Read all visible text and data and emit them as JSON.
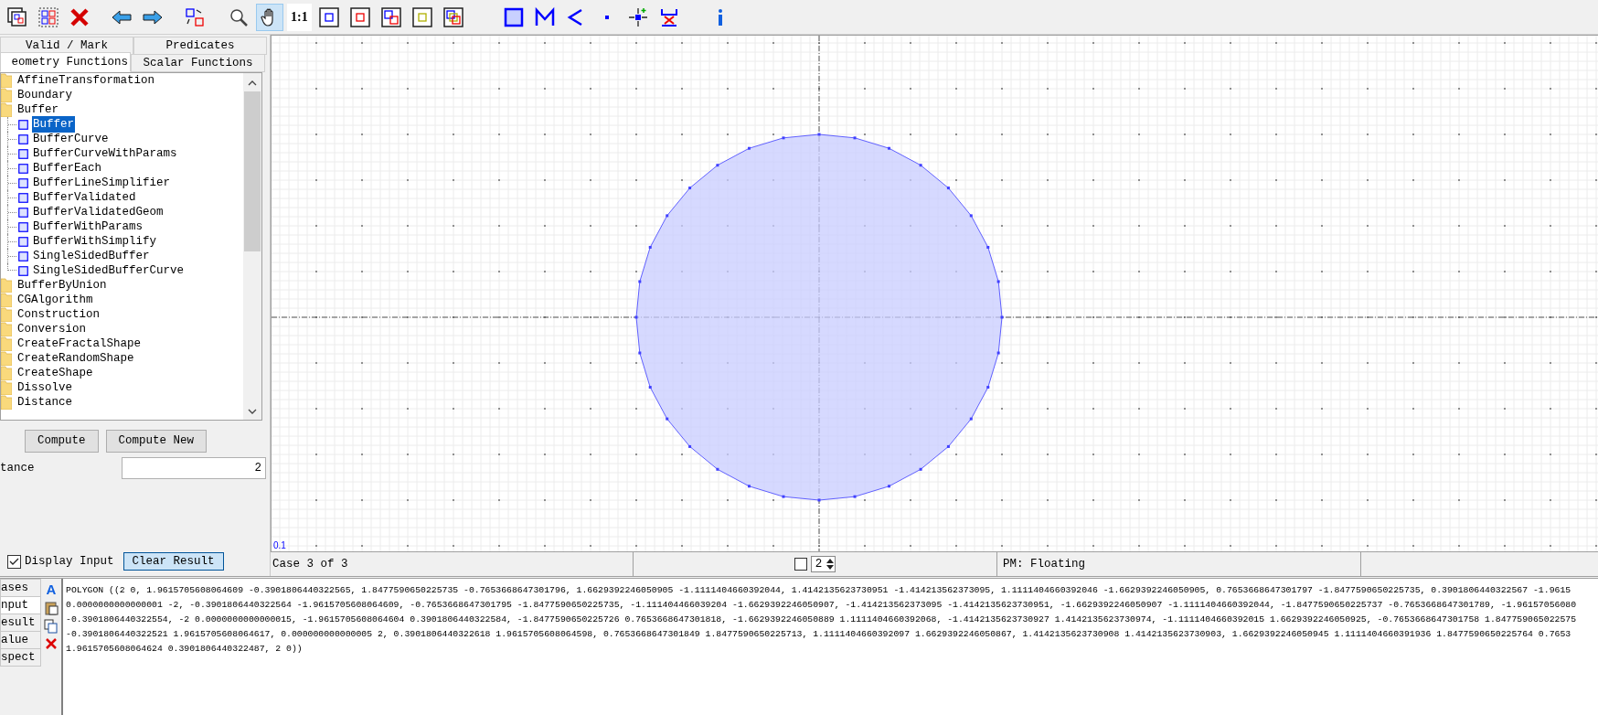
{
  "toolbar": [
    {
      "kind": "cases"
    },
    {
      "kind": "select-geoms"
    },
    {
      "kind": "delete"
    },
    {
      "kind": "back"
    },
    {
      "kind": "forward"
    },
    {
      "kind": "swap"
    },
    {
      "kind": "zoom",
      "selected": false
    },
    {
      "kind": "pan",
      "selected": true
    },
    {
      "kind": "text",
      "label": "1:1",
      "selected": false
    },
    {
      "kind": "geom-a",
      "selected": false
    },
    {
      "kind": "geom-b",
      "selected": false
    },
    {
      "kind": "geom-ab",
      "selected": false
    },
    {
      "kind": "geom-result",
      "selected": false
    },
    {
      "kind": "geom-all",
      "selected": false
    },
    {
      "kind": "polygon",
      "selected": false
    },
    {
      "kind": "linestring",
      "selected": false
    },
    {
      "kind": "line",
      "selected": false
    },
    {
      "kind": "point",
      "selected": false
    },
    {
      "kind": "edit-vertex",
      "selected": false
    },
    {
      "kind": "delete-vertex",
      "selected": false
    },
    {
      "kind": "info",
      "selected": false
    }
  ],
  "tabs_top": [
    {
      "label": "Valid / Mark",
      "selected": false
    },
    {
      "label": "Predicates",
      "selected": false
    }
  ],
  "tabs_bottom": [
    {
      "label": "eometry Functions",
      "selected": true
    },
    {
      "label": "Scalar Functions",
      "selected": false
    }
  ],
  "tree": [
    {
      "label": "AffineTransformation"
    },
    {
      "label": "Boundary"
    },
    {
      "label": "Buffer",
      "children": [
        {
          "label": "Buffer",
          "selected": true
        },
        {
          "label": "BufferCurve",
          "selected": false
        },
        {
          "label": "BufferCurveWithParams",
          "selected": false
        },
        {
          "label": "BufferEach",
          "selected": false
        },
        {
          "label": "BufferLineSimplifier",
          "selected": false
        },
        {
          "label": "BufferValidated",
          "selected": false
        },
        {
          "label": "BufferValidatedGeom",
          "selected": false
        },
        {
          "label": "BufferWithParams",
          "selected": false
        },
        {
          "label": "BufferWithSimplify",
          "selected": false
        },
        {
          "label": "SingleSidedBuffer",
          "selected": false
        },
        {
          "label": "SingleSidedBufferCurve",
          "selected": false
        }
      ]
    },
    {
      "label": "BufferByUnion"
    },
    {
      "label": "CGAlgorithm"
    },
    {
      "label": "Construction"
    },
    {
      "label": "Conversion"
    },
    {
      "label": "CreateFractalShape"
    },
    {
      "label": "CreateRandomShape"
    },
    {
      "label": "CreateShape"
    },
    {
      "label": "Dissolve"
    },
    {
      "label": "Distance"
    }
  ],
  "buttons": [
    "Compute",
    "Compute New"
  ],
  "parameter": {
    "label": "tance",
    "value": "2"
  },
  "display_input": {
    "label": "Display Input",
    "checked": true
  },
  "clear_result": "Clear Result",
  "canvas": {
    "scale_label": "0.1"
  },
  "text_panel": {
    "font_button": "A"
  },
  "status_bar": {
    "case": "Case 3 of 3",
    "check": false,
    "spinner": "2",
    "precision": "PM: Floating"
  },
  "bottom_tabs": [
    {
      "label": "ases",
      "selected": false
    },
    {
      "label": "nput",
      "selected": true
    },
    {
      "label": "esult",
      "selected": false
    },
    {
      "label": "alue",
      "selected": false
    },
    {
      "label": "spect",
      "selected": false
    }
  ],
  "wkt_lines": [
    "POLYGON ((2 0, 1.9615705608064609 -0.3901806440322565, 1.8477590650225735 -0.7653668647301796, 1.6629392246050905 -1.1111404660392044, 1.4142135623730951 -1.414213562373095, 1.1111404660392046 -1.6629392246050905, 0.7653668647301797 -1.8477590650225735, 0.3901806440322567 -1.9615",
    "0.0000000000000001 -2, -0.3901806440322564 -1.9615705608064609, -0.7653668647301795 -1.8477590650225735, -1.111404466039204 -1.6629392246050907, -1.414213562373095 -1.4142135623730951, -1.6629392246050907 -1.1111404660392044, -1.8477590650225737 -0.7653668647301789, -1.96157056080",
    "-0.3901806440322554, -2 0.0000000000000015, -1.9615705608064604 0.3901806440322584, -1.8477590650225726 0.7653668647301818, -1.6629392246050889 1.1111404660392068, -1.4142135623730927 1.4142135623730974, -1.1111404660392015 1.6629392246050925, -0.7653668647301758 1.847759065022575",
    "-0.3901806440322521 1.9615705608064617, 0.000000000000005 2, 0.3901806440322618 1.9615705608064598, 0.7653668647301849 1.8477590650225713, 1.1111404660392097 1.6629392246050867, 1.4142135623730908 1.4142135623730903, 1.6629392246050945 1.1111404660391936 1.8477590650225764 0.7653",
    "1.9615705608064624 0.3901806440322487, 2 0))"
  ]
}
